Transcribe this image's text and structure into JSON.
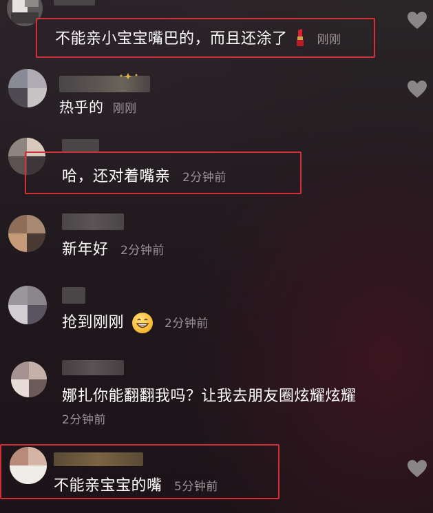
{
  "comments": [
    {
      "text": "不能亲小宝宝嘴巴的，而且还涂了",
      "time": "刚刚",
      "has_lipstick": true
    },
    {
      "text": "热乎的",
      "time": "刚刚"
    },
    {
      "text": "哈，还对着嘴亲",
      "time": "2分钟前"
    },
    {
      "text": "新年好",
      "time": "2分钟前"
    },
    {
      "text": "抢到刚刚",
      "time": "2分钟前",
      "has_emoji": true
    },
    {
      "text": "娜扎你能翻翻我吗？让我去朋友圈炫耀炫耀",
      "time": "2分钟前"
    },
    {
      "text": "不能亲宝宝的嘴",
      "time": "5分钟前"
    }
  ],
  "icons": {
    "like": "heart-outline-icon",
    "lipstick": "lipstick-icon",
    "grin": "grinning-face-icon"
  },
  "colors": {
    "highlight_box": "#d2303a",
    "time_text": "#9a9498"
  }
}
